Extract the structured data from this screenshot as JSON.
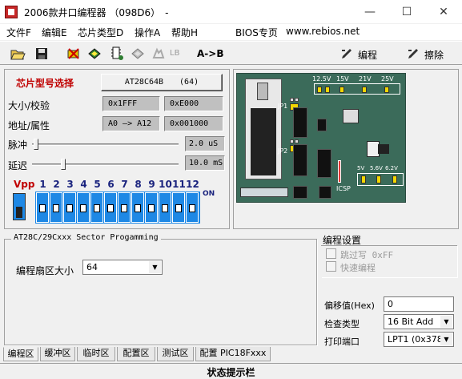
{
  "window": {
    "title": "2006款井口编程器 （098D6）　-",
    "min": "—",
    "max": "☐",
    "close": "✕"
  },
  "menu": [
    {
      "label": "文件F"
    },
    {
      "label": "编辑E"
    },
    {
      "label": "芯片类型D"
    },
    {
      "label": "操作A"
    },
    {
      "label": "帮助H"
    },
    {
      "label": "BIOS专页"
    },
    {
      "label": "www.rebios.net"
    }
  ],
  "toolbar": {
    "lb": "LB",
    "ab": "A->B",
    "program": "编程",
    "erase": "擦除"
  },
  "chip": {
    "select_label": "芯片型号选择",
    "model": "AT28C64B　　(64)",
    "size_label": "大小/校验",
    "size": "0x1FFF",
    "checksum": "0xE000",
    "addr_label": "地址/属性",
    "addr": "A0 —> A12",
    "attr": "0x001000",
    "pulse_label": "脉冲",
    "pulse": "2.0 uS",
    "delay_label": "延迟",
    "delay": "10.0 mS",
    "vpp": "Vpp",
    "on": "ON",
    "switch_numbers": [
      "1",
      "2",
      "3",
      "4",
      "5",
      "6",
      "7",
      "8",
      "9",
      "10",
      "11",
      "12"
    ]
  },
  "board": {
    "jp1": "JP1",
    "jp2": "JP2",
    "icsp": "ICSP",
    "v125": "12.5V",
    "v15": "15V",
    "v21": "21V",
    "v25": "25V",
    "v5": "5V",
    "v56": "5.6V",
    "v62": "6.2V"
  },
  "sector": {
    "group_title": "AT28C/29Cxxx Sector Progamming",
    "size_label": "编程扇区大小",
    "size_value": "64"
  },
  "settings": {
    "title": "编程设置",
    "skip_label": "跳过写 0xFF",
    "fast_label": "快速编程",
    "offset_label": "偏移值(Hex)",
    "offset_value": "0",
    "check_label": "检查类型",
    "check_value": "16 Bit Add",
    "port_label": "打印端口",
    "port_value": "LPT1 (0x378)"
  },
  "tabs": [
    {
      "label": "编程区"
    },
    {
      "label": "缓冲区"
    },
    {
      "label": "临时区"
    },
    {
      "label": "配置区"
    },
    {
      "label": "测试区"
    },
    {
      "label": "配置 PIC18Fxxx"
    }
  ],
  "status": "状态提示栏",
  "colors": {
    "red_label": "#c00000",
    "vpp_blue": "#1e88e5",
    "board_green": "#3b6b5a"
  }
}
